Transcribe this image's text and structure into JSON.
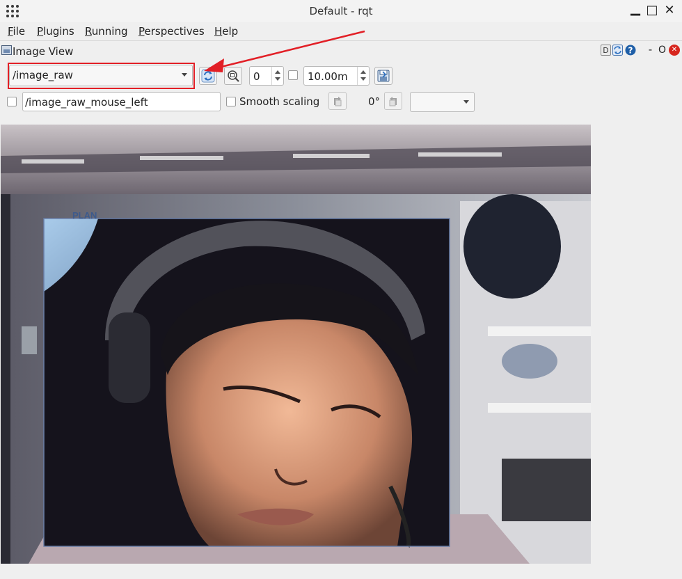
{
  "window": {
    "title": "Default - rqt",
    "minimize_glyph": "▁",
    "maximize_glyph": "□",
    "close_glyph": "✕"
  },
  "menu": {
    "items": [
      {
        "accel": "F",
        "rest": "ile"
      },
      {
        "accel": "P",
        "rest": "lugins"
      },
      {
        "accel": "R",
        "rest": "unning"
      },
      {
        "accel": "P",
        "rest": "erspectives"
      },
      {
        "accel": "H",
        "rest": "elp"
      }
    ]
  },
  "plugin": {
    "title": "Image View",
    "buttons": {
      "d": "D",
      "minimize": "-",
      "float": "O",
      "close": "✕"
    }
  },
  "toolbar": {
    "topic_value": "/image_raw",
    "zoom_value": "0",
    "duration_value": "10.00m",
    "mouse_topic_value": "/image_raw_mouse_left",
    "smooth_scaling_label": "Smooth scaling",
    "rotation_label": "0°",
    "topic_checked": false,
    "smooth_checked": false
  },
  "colors": {
    "highlight": "#e21f26",
    "refresh_blue": "#2a6fc1"
  },
  "icons": [
    "apps-grid-icon",
    "refresh-icon",
    "zoom-icon",
    "save-icon",
    "rotate-left-icon",
    "rotate-right-icon",
    "help-icon"
  ]
}
